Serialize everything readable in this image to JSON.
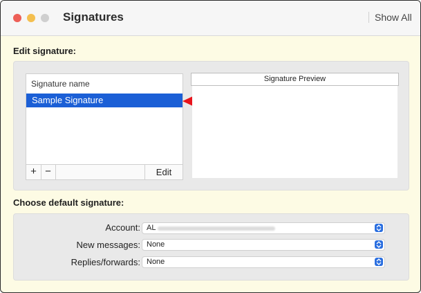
{
  "window": {
    "title": "Signatures",
    "show_all": "Show All"
  },
  "edit_section": {
    "label": "Edit signature:",
    "list_header": "Signature name",
    "signatures": [
      "Sample Signature"
    ],
    "add_label": "+",
    "remove_label": "−",
    "edit_label": "Edit",
    "preview_title": "Signature Preview"
  },
  "default_section": {
    "label": "Choose default signature:",
    "account_label": "Account:",
    "account_value": "AL",
    "new_messages_label": "New messages:",
    "new_messages_value": "None",
    "replies_label": "Replies/forwards:",
    "replies_value": "None"
  },
  "colors": {
    "selection": "#1b5fd6",
    "annotation_arrow": "#e8141c",
    "window_bg": "#fdfbe4"
  }
}
